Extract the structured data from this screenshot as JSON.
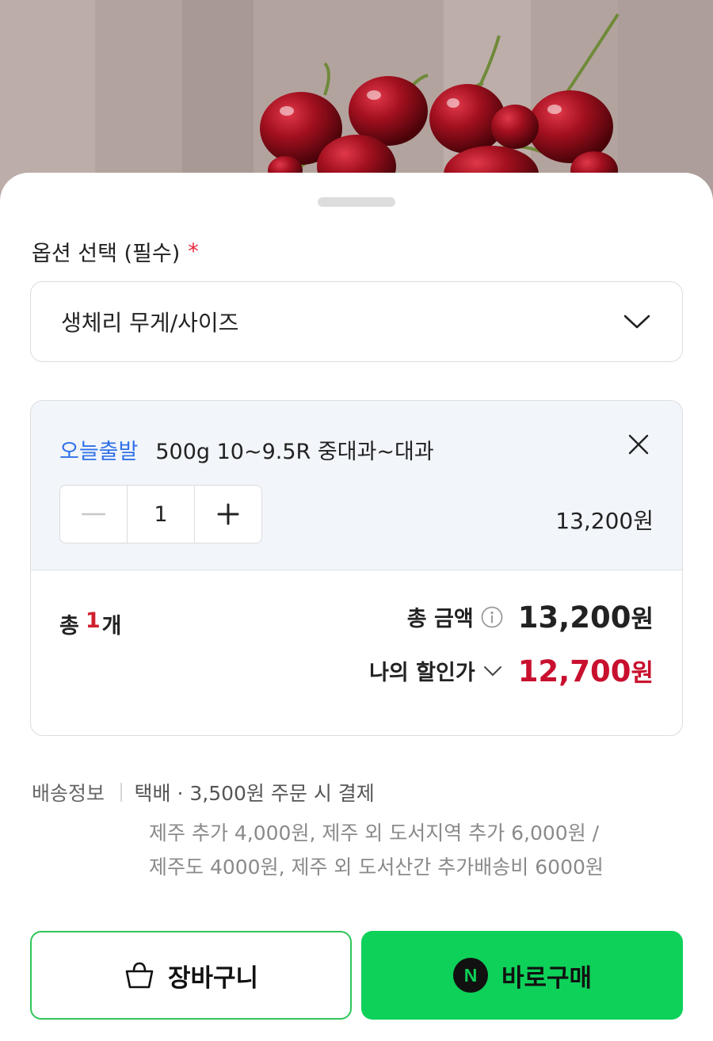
{
  "sheet": {
    "option_title": "옵션 선택 (필수)",
    "required_mark": "*",
    "select_value": "생체리 무게/사이즈"
  },
  "selected_option": {
    "badge": "오늘출발",
    "name": "500g 10~9.5R 중대과~대과",
    "quantity": "1",
    "price": "13,200원",
    "minus_icon": "minus-icon",
    "plus_icon": "plus-icon",
    "close_icon": "close-icon"
  },
  "summary": {
    "total_prefix": "총",
    "total_count": "1",
    "total_suffix": "개",
    "total_label": "총 금액",
    "total_amount": "13,200",
    "total_unit": "원",
    "discount_label": "나의 할인가",
    "discount_amount": "12,700",
    "discount_unit": "원"
  },
  "delivery": {
    "label": "배송정보",
    "main": "택배 · 3,500원 주문 시 결제",
    "note_line1": "제주 추가 4,000원, 제주 외 도서지역 추가 6,000원 /",
    "note_line2": "제주도 4000원, 제주 외 도서산간 추가배송비 6000원"
  },
  "buttons": {
    "cart_label": "장바구니",
    "buy_label": "바로구매",
    "npay_letter": "N"
  },
  "colors": {
    "required": "#e8283a",
    "badge_blue": "#2f71e8",
    "discount_red": "#c8102e",
    "buy_green": "#0ed159",
    "cart_border": "#2fc658"
  }
}
